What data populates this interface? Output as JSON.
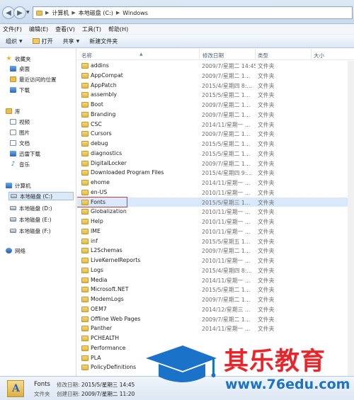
{
  "address_bar": {
    "crumbs": [
      "计算机",
      "本地磁盘 (C:)",
      "Windows"
    ]
  },
  "menu": [
    "文件(F)",
    "编辑(E)",
    "查看(V)",
    "工具(T)",
    "帮助(H)"
  ],
  "toolbar": {
    "organize": "组织",
    "open": "打开",
    "share": "共享",
    "new_folder": "新建文件夹"
  },
  "nav": {
    "favorites": "收藏夹",
    "desktop": "桌面",
    "recent": "最近访问的位置",
    "downloads": "下载",
    "libraries": "库",
    "videos": "视频",
    "pictures": "图片",
    "documents": "文档",
    "xunlei": "迅雷下载",
    "music": "音乐",
    "computer": "计算机",
    "drive_c": "本地磁盘 (C:)",
    "drive_d": "本地磁盘 (D:)",
    "drive_e": "本地磁盘 (E:)",
    "drive_f": "本地磁盘 (F:)",
    "network": "网络"
  },
  "columns": {
    "name": "名称",
    "date": "修改日期",
    "type": "类型",
    "size": "大小"
  },
  "files": [
    {
      "name": "addins",
      "date": "2009/7/星期二 14:45",
      "type": "文件夹"
    },
    {
      "name": "AppCompat",
      "date": "2009/7/星期二 1...",
      "type": "文件夹"
    },
    {
      "name": "AppPatch",
      "date": "2015/4/星期四 8:...",
      "type": "文件夹"
    },
    {
      "name": "assembly",
      "date": "2015/5/星期二 1...",
      "type": "文件夹"
    },
    {
      "name": "Boot",
      "date": "2009/7/星期二 1...",
      "type": "文件夹"
    },
    {
      "name": "Branding",
      "date": "2009/7/星期二 1...",
      "type": "文件夹"
    },
    {
      "name": "CSC",
      "date": "2014/11/星期一 ...",
      "type": "文件夹"
    },
    {
      "name": "Cursors",
      "date": "2009/7/星期二 1...",
      "type": "文件夹"
    },
    {
      "name": "debug",
      "date": "2015/5/星期二 1...",
      "type": "文件夹"
    },
    {
      "name": "diagnostics",
      "date": "2015/5/星期二 1...",
      "type": "文件夹"
    },
    {
      "name": "DigitalLocker",
      "date": "2009/7/星期二 1...",
      "type": "文件夹"
    },
    {
      "name": "Downloaded Program Files",
      "date": "2015/4/星期四 9:...",
      "type": "文件夹"
    },
    {
      "name": "ehome",
      "date": "2014/11/星期一 ...",
      "type": "文件夹"
    },
    {
      "name": "en-US",
      "date": "2010/11/星期一 ...",
      "type": "文件夹"
    },
    {
      "name": "Fonts",
      "date": "2015/5/星期三 1...",
      "type": "文件夹"
    },
    {
      "name": "Globalization",
      "date": "2010/11/星期一 ...",
      "type": "文件夹"
    },
    {
      "name": "Help",
      "date": "2010/11/星期一 ...",
      "type": "文件夹"
    },
    {
      "name": "IME",
      "date": "2010/11/星期一 ...",
      "type": "文件夹"
    },
    {
      "name": "inf",
      "date": "2015/5/星期五 1...",
      "type": "文件夹"
    },
    {
      "name": "L2Schemas",
      "date": "2009/7/星期二 1...",
      "type": "文件夹"
    },
    {
      "name": "LiveKernelReports",
      "date": "2010/11/星期一 ...",
      "type": "文件夹"
    },
    {
      "name": "Logs",
      "date": "2015/4/星期四 8:...",
      "type": "文件夹"
    },
    {
      "name": "Media",
      "date": "2014/11/星期一 ...",
      "type": "文件夹"
    },
    {
      "name": "Microsoft.NET",
      "date": "2015/5/星期二 1...",
      "type": "文件夹"
    },
    {
      "name": "ModemLogs",
      "date": "2009/7/星期二 1...",
      "type": "文件夹"
    },
    {
      "name": "OEM7",
      "date": "2014/12/星期三 ...",
      "type": "文件夹"
    },
    {
      "name": "Offline Web Pages",
      "date": "2009/7/星期二 1...",
      "type": "文件夹"
    },
    {
      "name": "Panther",
      "date": "2014/11/星期一 ...",
      "type": "文件夹"
    },
    {
      "name": "PCHEALTH",
      "date": "",
      "type": ""
    },
    {
      "name": "Performance",
      "date": "",
      "type": ""
    },
    {
      "name": "PLA",
      "date": "",
      "type": ""
    },
    {
      "name": "PolicyDefinitions",
      "date": "",
      "type": ""
    }
  ],
  "details": {
    "name": "Fonts",
    "type": "文件夹",
    "modified_label": "修改日期:",
    "modified_value": "2015/5/星期三 14:45",
    "created_label": "创建日期:",
    "created_value": "2009/7/星期二 11:20"
  },
  "watermark": {
    "text": "其乐教育",
    "url": "www.76edu.com"
  }
}
